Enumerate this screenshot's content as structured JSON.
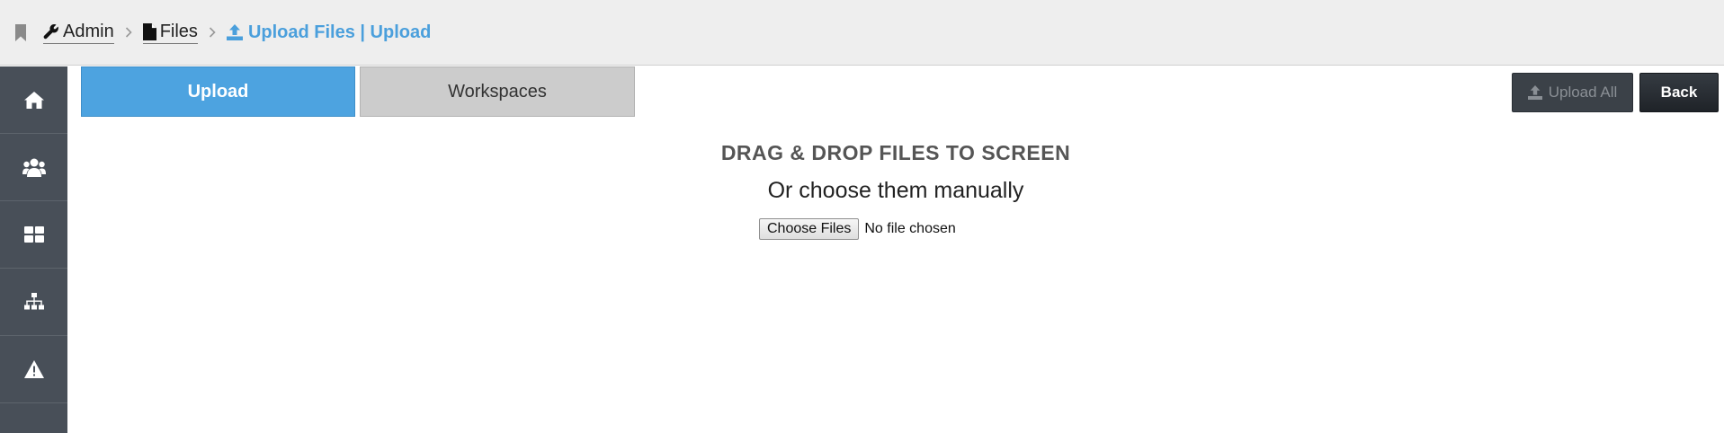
{
  "breadcrumb": {
    "admin_label": "Admin",
    "files_label": "Files",
    "current_label": "Upload Files | Upload"
  },
  "sidebar": {
    "items": [
      {
        "icon": "home-icon"
      },
      {
        "icon": "users-icon"
      },
      {
        "icon": "dashboard-icon"
      },
      {
        "icon": "sitemap-icon"
      },
      {
        "icon": "warning-icon"
      }
    ]
  },
  "tabs": {
    "upload_label": "Upload",
    "workspaces_label": "Workspaces"
  },
  "toolbar": {
    "upload_all_label": "Upload All",
    "back_label": "Back"
  },
  "dropzone": {
    "title": "DRAG & DROP FILES TO SCREEN",
    "subtitle": "Or choose them manually",
    "choose_label": "Choose Files",
    "status": "No file chosen"
  },
  "colors": {
    "accent": "#4da3e0",
    "sidebar": "#484f58",
    "topbar": "#eeeeee"
  }
}
